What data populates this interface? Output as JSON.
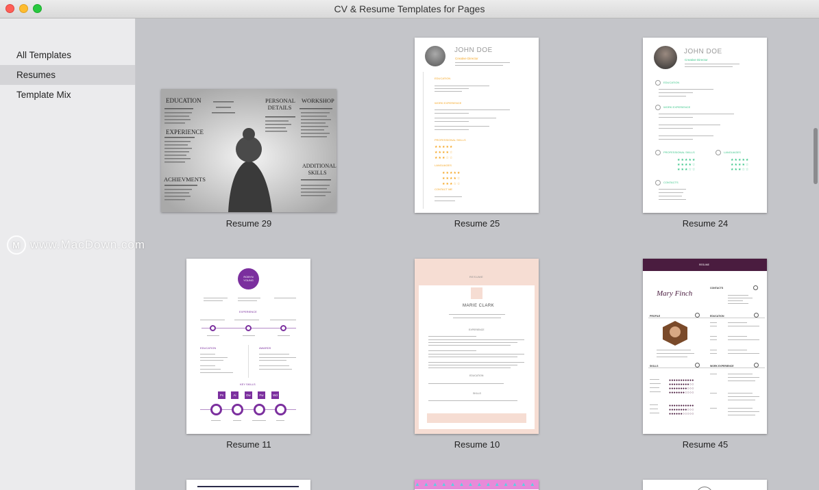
{
  "window": {
    "title": "CV & Resume Templates for Pages"
  },
  "sidebar": {
    "items": [
      {
        "label": "All Templates",
        "selected": false
      },
      {
        "label": "Resumes",
        "selected": true
      },
      {
        "label": "Template Mix",
        "selected": false
      }
    ]
  },
  "watermark": {
    "text": "www.MacDown.com"
  },
  "templates": [
    {
      "name": "Resume 29",
      "headings": [
        "EDUCATION",
        "EXPERIENCE",
        "ACHIEVMENTS",
        "PERSONAL DETAILS",
        "WORKSHOP",
        "ADDITIONAL SKILLS"
      ]
    },
    {
      "name": "Resume 25",
      "person": "JOHN DOE",
      "role": "Creative Director",
      "sections": [
        "EDUCATION",
        "WORK EXPERIENCE",
        "PROFESSIONAL SKILLS",
        "LANGUAGES",
        "CONTACT ME"
      ]
    },
    {
      "name": "Resume 24",
      "person": "JOHN DOE",
      "role": "Creative Director",
      "sections": [
        "EDUCATION",
        "WORK EXPERIENCE",
        "PROFESSIONAL SKILLS",
        "LANGUAGES",
        "CONTACTS"
      ]
    },
    {
      "name": "Resume 11",
      "person": "ROBYN YOUNG",
      "sections": [
        "EXPERIENCE",
        "EDUCATION",
        "AWARDS",
        "KEY SKILLS"
      ],
      "skill_icons": [
        "Ps",
        "Ai",
        "Dw",
        "Fw",
        "Wd"
      ]
    },
    {
      "name": "Resume 10",
      "header": "RESUME",
      "person": "MARIE CLARK",
      "sections": [
        "EXPERIENCE",
        "EDUCATION",
        "SKILLS"
      ]
    },
    {
      "name": "Resume 45",
      "header": "RESUME",
      "person": "Mary Finch",
      "sections": [
        "CONTACTS",
        "PROFILE",
        "EDUCATION",
        "SKILLS",
        "WORK EXPERIENCE"
      ]
    }
  ],
  "colors": {
    "accent_orange": "#f5a623",
    "accent_green": "#3cc68a",
    "accent_purple": "#7b2f9e",
    "accent_plum": "#4a1c3f",
    "peach": "#f6ddd3",
    "pink_strip": "#e88ad8"
  }
}
